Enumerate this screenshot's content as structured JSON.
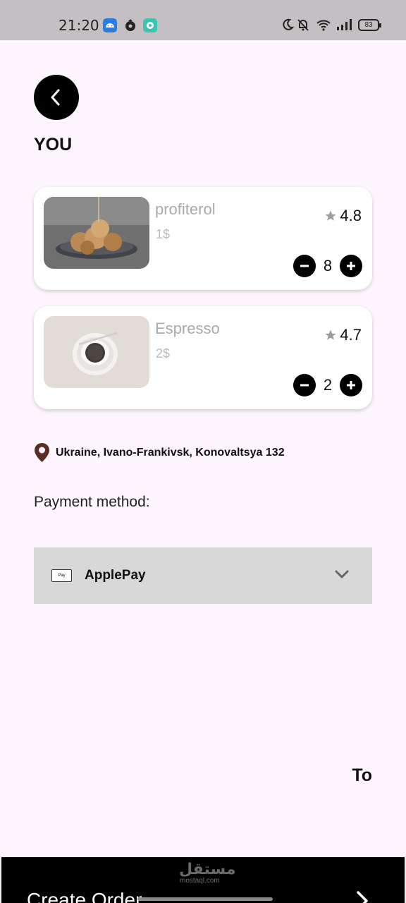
{
  "status_bar": {
    "time": "21:20",
    "battery": "83",
    "icons": [
      "android-notification-icon",
      "app-notification-icon",
      "chat-notification-icon",
      "moon-icon",
      "mute-bell-icon",
      "wifi-icon",
      "signal-icon",
      "battery-icon"
    ]
  },
  "header": {
    "back_icon": "chevron-left-icon",
    "title": "YOU"
  },
  "cart": {
    "items": [
      {
        "name": "profiterol",
        "price": "1$",
        "rating": "4.8",
        "quantity": "8",
        "image": "profiterole-photo"
      },
      {
        "name": "Espresso",
        "price": "2$",
        "rating": "4.7",
        "quantity": "2",
        "image": "espresso-cup-photo"
      }
    ]
  },
  "address": {
    "icon": "location-pin-icon",
    "text": "Ukraine, Ivano-Frankivsk, Konovaltsya 132"
  },
  "payment": {
    "label": "Payment method:",
    "selected": "ApplePay",
    "icon_text": "Pay"
  },
  "total": {
    "label": "To"
  },
  "footer": {
    "button_label": "Create Order",
    "watermark_ar": "مستقل",
    "watermark_en": "mostaql.com"
  },
  "colors": {
    "background": "#fdf6fe",
    "status_bar": "#c4bfc3",
    "primary": "#000000",
    "dropdown": "#d8d8d8",
    "pin": "#5a2f22"
  }
}
